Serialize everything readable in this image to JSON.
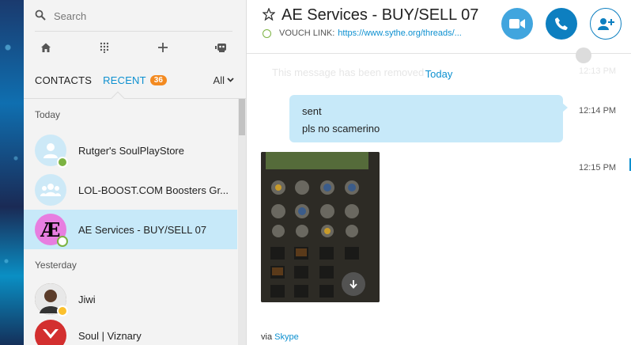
{
  "search": {
    "placeholder": "Search"
  },
  "tabs": {
    "contacts": "CONTACTS",
    "recent": "RECENT",
    "recent_count": "36",
    "filter": "All"
  },
  "sections": {
    "today": "Today",
    "yesterday": "Yesterday"
  },
  "contacts": [
    {
      "name": "Rutger's SoulPlayStore",
      "status": "online"
    },
    {
      "name": "LOL-BOOST.COM Boosters Gr...",
      "status": "none"
    },
    {
      "name": "AE Services - BUY/SELL 07",
      "status": "online",
      "active": true,
      "avatar_text": "Æ"
    },
    {
      "name": "Jiwi",
      "status": "away"
    },
    {
      "name": "Soul | Viznary",
      "status": "none"
    }
  ],
  "conversation": {
    "title": "AE Services - BUY/SELL 07",
    "link_label": "VOUCH LINK:",
    "link_url": "https://www.sythe.org/threads/...",
    "removed_note": "This message has been removed",
    "removed_time": "12:13 PM",
    "day_label": "Today",
    "messages": [
      {
        "lines": [
          "sent",
          "pls no scamerino"
        ],
        "time": "12:14 PM"
      },
      {
        "type": "image",
        "time": "12:15 PM"
      }
    ],
    "via_prefix": "via",
    "via_app": "Skype"
  },
  "colors": {
    "accent": "#0d90d0",
    "active_row": "#c7e9f9",
    "badge": "#f38a20",
    "online": "#7cb342",
    "away": "#fbc02d"
  }
}
